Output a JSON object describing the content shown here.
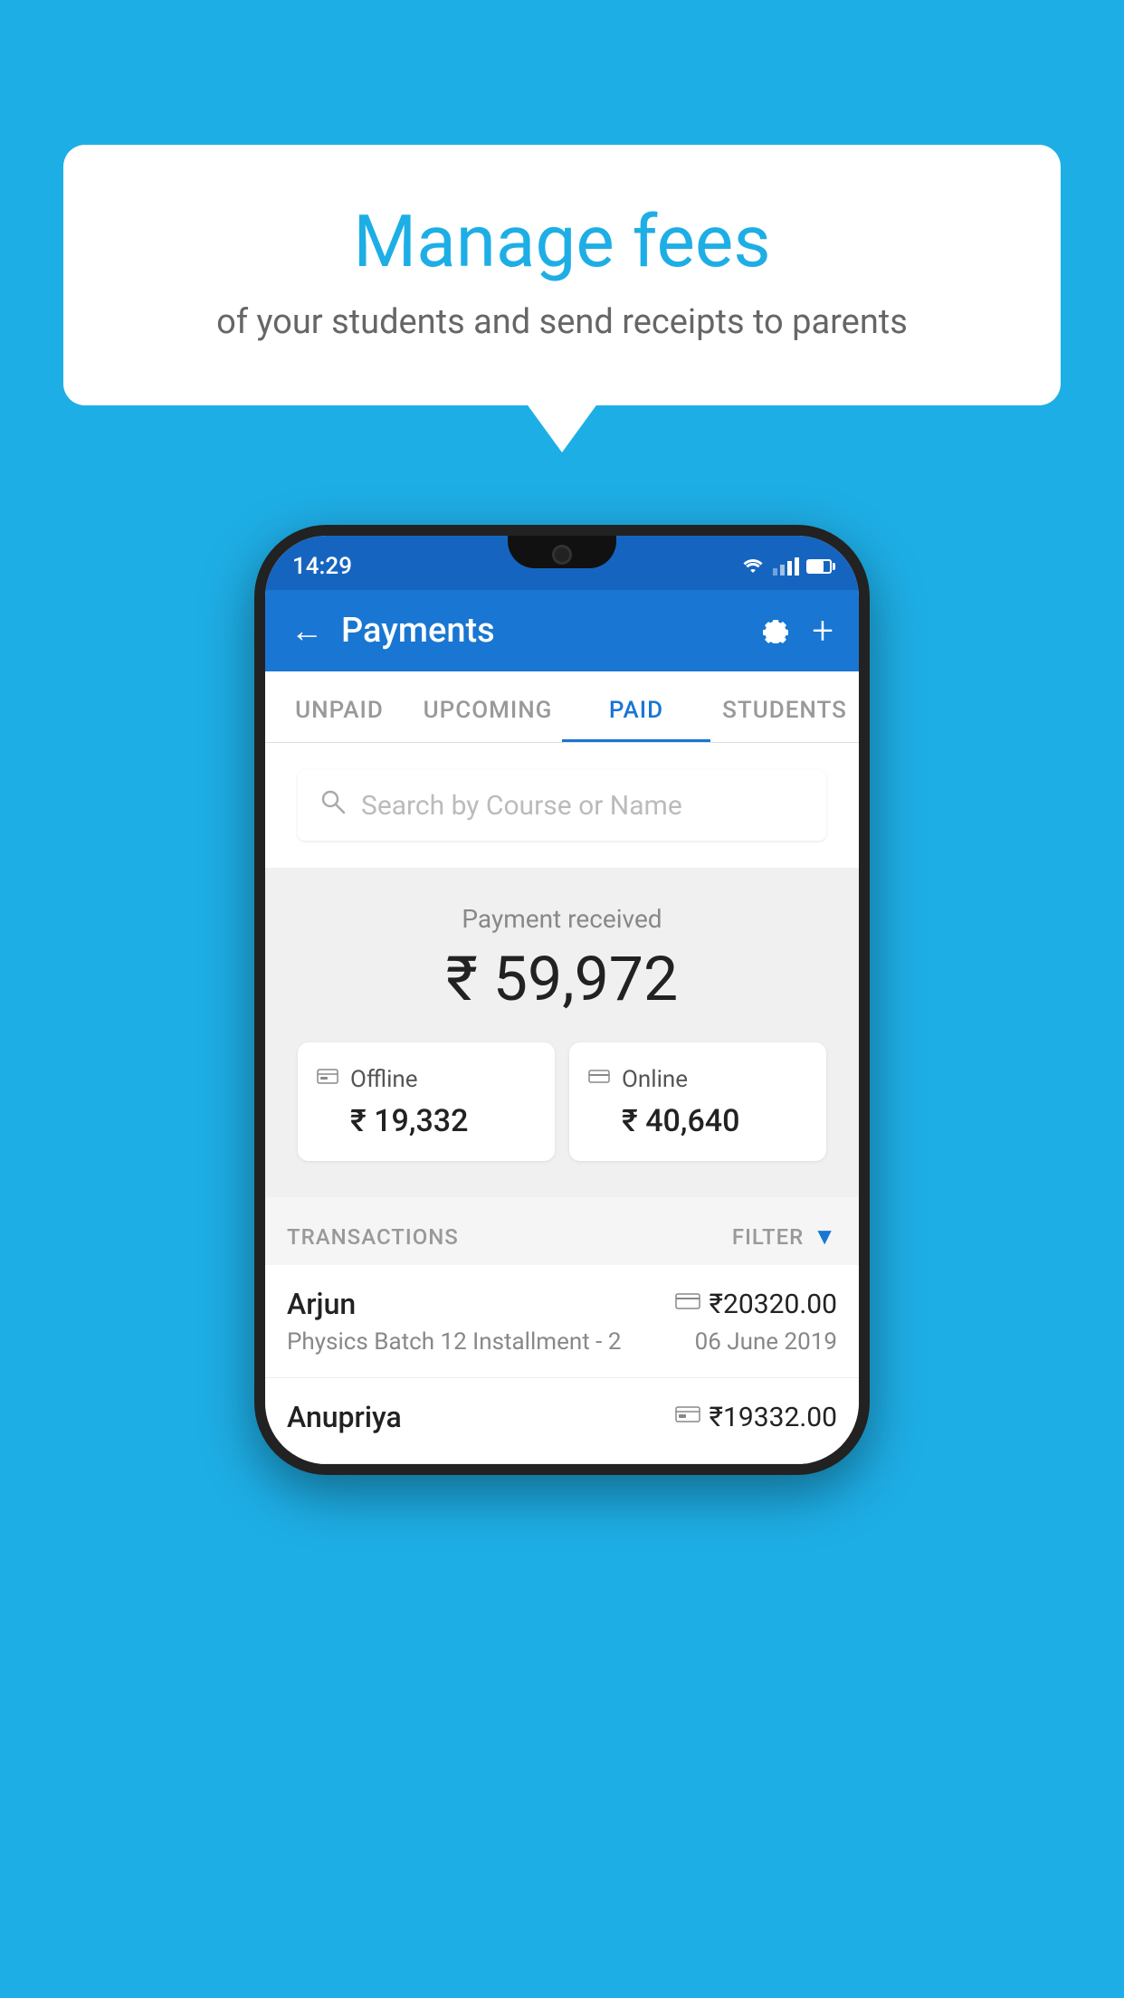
{
  "background_color": "#1EAEE6",
  "bubble": {
    "title": "Manage fees",
    "subtitle": "of your students and send receipts to parents"
  },
  "status_bar": {
    "time": "14:29"
  },
  "header": {
    "title": "Payments"
  },
  "tabs": [
    {
      "label": "UNPAID",
      "active": false
    },
    {
      "label": "UPCOMING",
      "active": false
    },
    {
      "label": "PAID",
      "active": true
    },
    {
      "label": "STUDENTS",
      "active": false
    }
  ],
  "search": {
    "placeholder": "Search by Course or Name"
  },
  "payment": {
    "label": "Payment received",
    "amount": "₹ 59,972",
    "offline": {
      "type": "Offline",
      "amount": "₹ 19,332"
    },
    "online": {
      "type": "Online",
      "amount": "₹ 40,640"
    }
  },
  "transactions_label": "TRANSACTIONS",
  "filter_label": "FILTER",
  "transactions": [
    {
      "name": "Arjun",
      "amount": "₹20320.00",
      "type": "online",
      "course": "Physics Batch 12 Installment - 2",
      "date": "06 June 2019"
    },
    {
      "name": "Anupriya",
      "amount": "₹19332.00",
      "type": "offline",
      "course": "",
      "date": ""
    }
  ]
}
